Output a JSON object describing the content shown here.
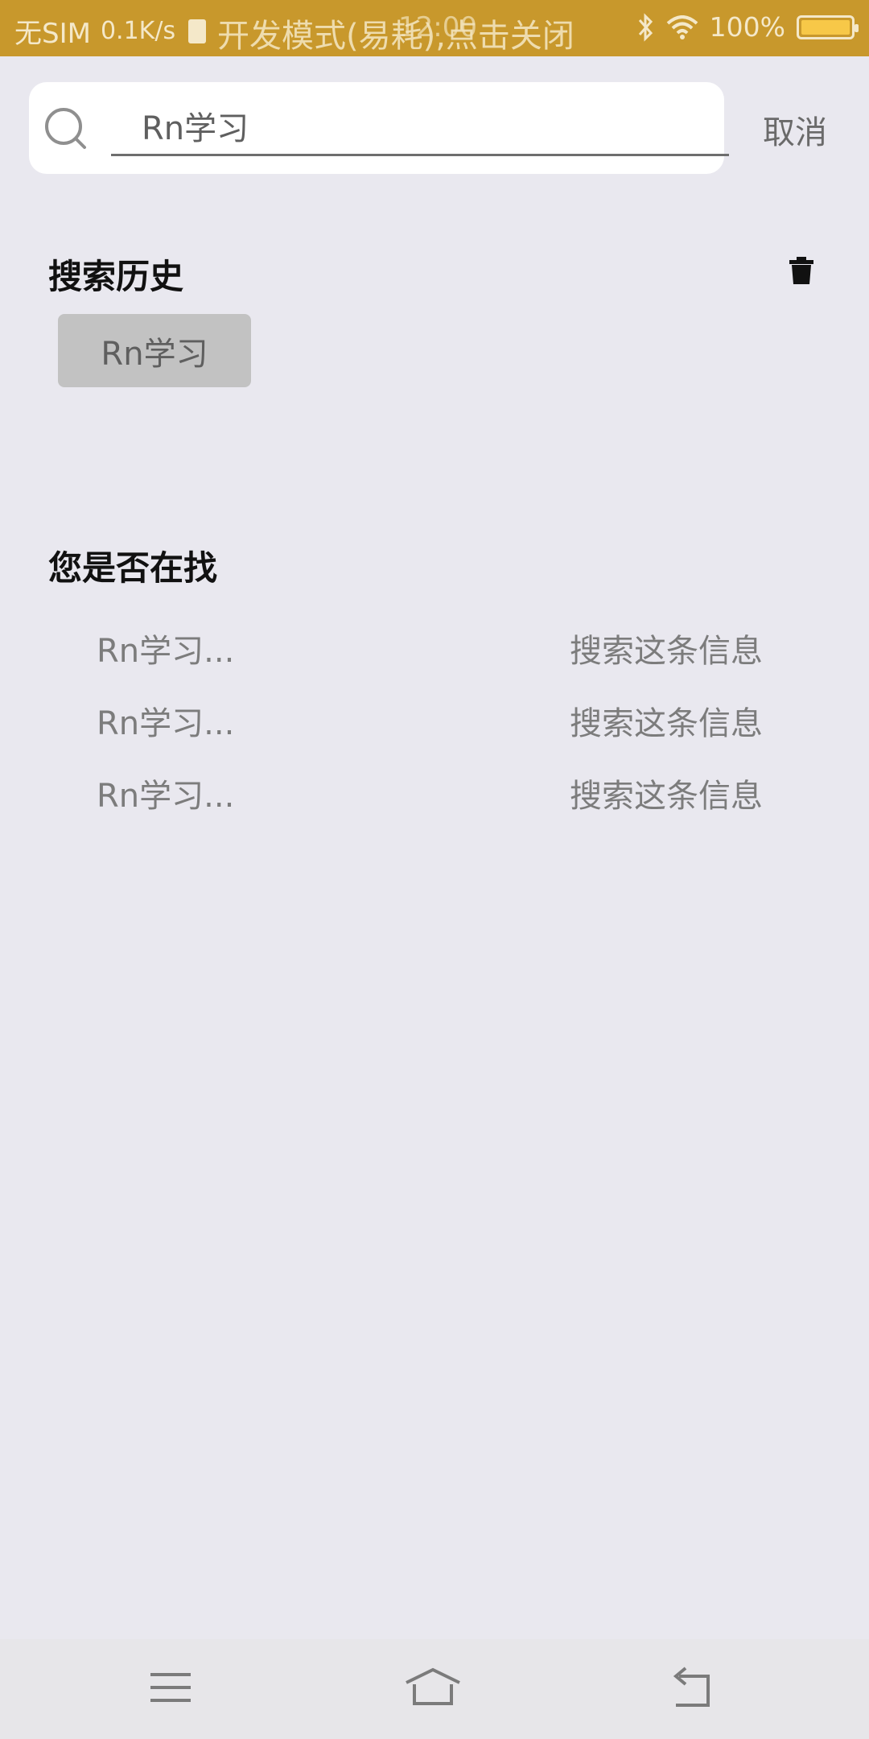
{
  "status_bar": {
    "carrier": "无SIM",
    "speed": "0.1K/s",
    "dev_banner": "开发模式(易耗),点击关闭",
    "time": "12:00",
    "battery": "100%",
    "battery_level": 1.0
  },
  "search": {
    "value": "Rn学习",
    "placeholder": "Rn学习",
    "cancel_label": "取消"
  },
  "history": {
    "title": "搜索历史",
    "chips": [
      "Rn学习"
    ]
  },
  "suggestions": {
    "title": "您是否在找",
    "items": [
      {
        "term": "Rn学习...",
        "action": "搜索这条信息"
      },
      {
        "term": "Rn学习...",
        "action": "搜索这条信息"
      },
      {
        "term": "Rn学习...",
        "action": "搜索这条信息"
      }
    ]
  },
  "colors": {
    "status_bar": "#c8982c",
    "background": "#e9e8ef",
    "chip": "#c2c2c2"
  },
  "icons": {
    "search": "search-icon",
    "trash": "trash-icon",
    "menu": "menu-icon",
    "home": "home-icon",
    "back": "back-icon"
  }
}
